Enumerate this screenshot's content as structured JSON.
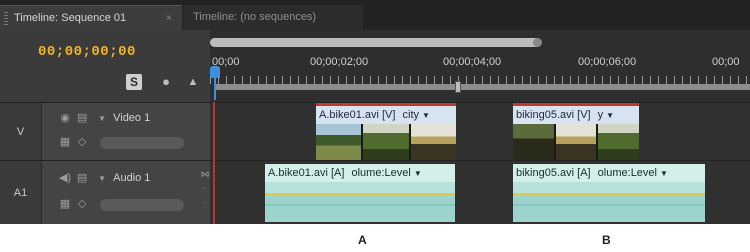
{
  "tabs": [
    {
      "label": "Timeline: Sequence 01",
      "close": "×",
      "active": true
    },
    {
      "label": "Timeline: (no sequences)",
      "active": false
    }
  ],
  "timecode": "00;00;00;00",
  "header_buttons": {
    "snap": "S",
    "marker": "●",
    "lock": "▲"
  },
  "ruler": {
    "ticks": [
      "00;00",
      "00;00;02;00",
      "00;00;04;00",
      "00;00;06;00",
      "00;00"
    ]
  },
  "tracks": {
    "video": {
      "id": "V",
      "name": "Video 1"
    },
    "audio": {
      "id": "A1",
      "name": "Audio 1"
    }
  },
  "clips": {
    "video": [
      {
        "title": "A.bike01.avi [V]",
        "effect": "city"
      },
      {
        "title": "biking05.avi [V]",
        "effect": "y"
      }
    ],
    "audio": [
      {
        "title": "A.bike01.avi [A]",
        "effect": "olume:Level"
      },
      {
        "title": "biking05.avi [A]",
        "effect": "olume:Level"
      }
    ]
  },
  "callouts": {
    "a": "A",
    "b": "B"
  },
  "colors": {
    "timecode": "#f0b429",
    "playhead": "#3f8fe0",
    "video_clip": "#d8e3f2",
    "audio_clip": "#9fd3cc",
    "in_point": "#c0392b"
  }
}
